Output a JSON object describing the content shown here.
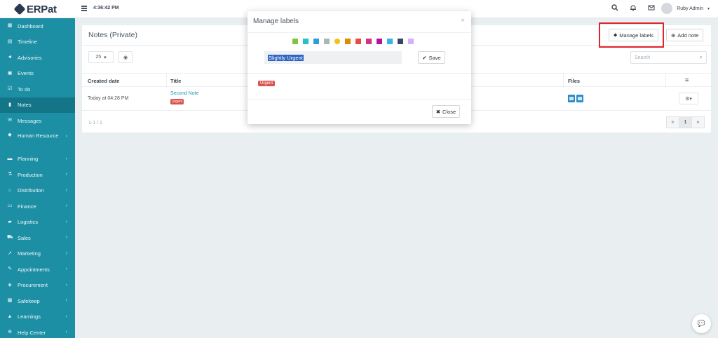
{
  "header": {
    "logo_text": "ERPat",
    "time": "4:36:42 PM",
    "user_name": "Ruby Admin",
    "icons": [
      "search-icon",
      "bell-icon",
      "mail-icon"
    ]
  },
  "sidebar": {
    "items": [
      {
        "label": "Dashboard",
        "icon": "dashboard-icon",
        "has_sub": false
      },
      {
        "label": "Timeline",
        "icon": "timeline-icon",
        "has_sub": false
      },
      {
        "label": "Advisories",
        "icon": "megaphone-icon",
        "has_sub": false
      },
      {
        "label": "Events",
        "icon": "calendar-icon",
        "has_sub": false
      },
      {
        "label": "To do",
        "icon": "checkbox-icon",
        "has_sub": false
      },
      {
        "label": "Notes",
        "icon": "book-icon",
        "has_sub": false,
        "active": true
      },
      {
        "label": "Messages",
        "icon": "envelope-icon",
        "has_sub": false
      },
      {
        "label": "Human Resource",
        "icon": "users-icon",
        "has_sub": true
      },
      {
        "label": "Planning",
        "icon": "briefcase-icon",
        "has_sub": true
      },
      {
        "label": "Production",
        "icon": "flask-icon",
        "has_sub": true
      },
      {
        "label": "Distribution",
        "icon": "bank-icon",
        "has_sub": true
      },
      {
        "label": "Finance",
        "icon": "money-icon",
        "has_sub": true
      },
      {
        "label": "Logistics",
        "icon": "truck-icon",
        "has_sub": true
      },
      {
        "label": "Sales",
        "icon": "cart-icon",
        "has_sub": true
      },
      {
        "label": "Marketing",
        "icon": "chart-icon",
        "has_sub": true
      },
      {
        "label": "Appointments",
        "icon": "edit-icon",
        "has_sub": true
      },
      {
        "label": "Procurement",
        "icon": "cubes-icon",
        "has_sub": true
      },
      {
        "label": "Safekeep",
        "icon": "archive-icon",
        "has_sub": true
      },
      {
        "label": "Learnings",
        "icon": "graduation-cap-icon",
        "has_sub": true
      },
      {
        "label": "Help Center",
        "icon": "life-ring-icon",
        "has_sub": true
      }
    ]
  },
  "main": {
    "title": "Notes (Private)",
    "manage_labels_button": "Manage labels",
    "add_note_button": "Add note",
    "page_size": "25",
    "search_placeholder": "Search",
    "columns": {
      "created_date": "Created date",
      "title": "Title",
      "files": "Files"
    },
    "rows": [
      {
        "created_date": "Today at 04:28 PM",
        "title": "Second Note",
        "label": "Urgent",
        "files_count": 2
      }
    ],
    "pagination_summary": "1-1 / 1",
    "pagination": {
      "prev": "«",
      "current": "1",
      "next": "»"
    }
  },
  "modal": {
    "title": "Manage labels",
    "colors": [
      "#83c340",
      "#29c2c2",
      "#2d9cdb",
      "#aab7b7",
      "#f1c40f",
      "#e18a00",
      "#e74c3c",
      "#d43480",
      "#ad159e",
      "#37b4e1",
      "#34495e",
      "#dbadff"
    ],
    "label_input_value": "Slightly Urgent",
    "save_button": "Save",
    "existing_labels": [
      "Urgent"
    ],
    "close_button": "Close"
  }
}
